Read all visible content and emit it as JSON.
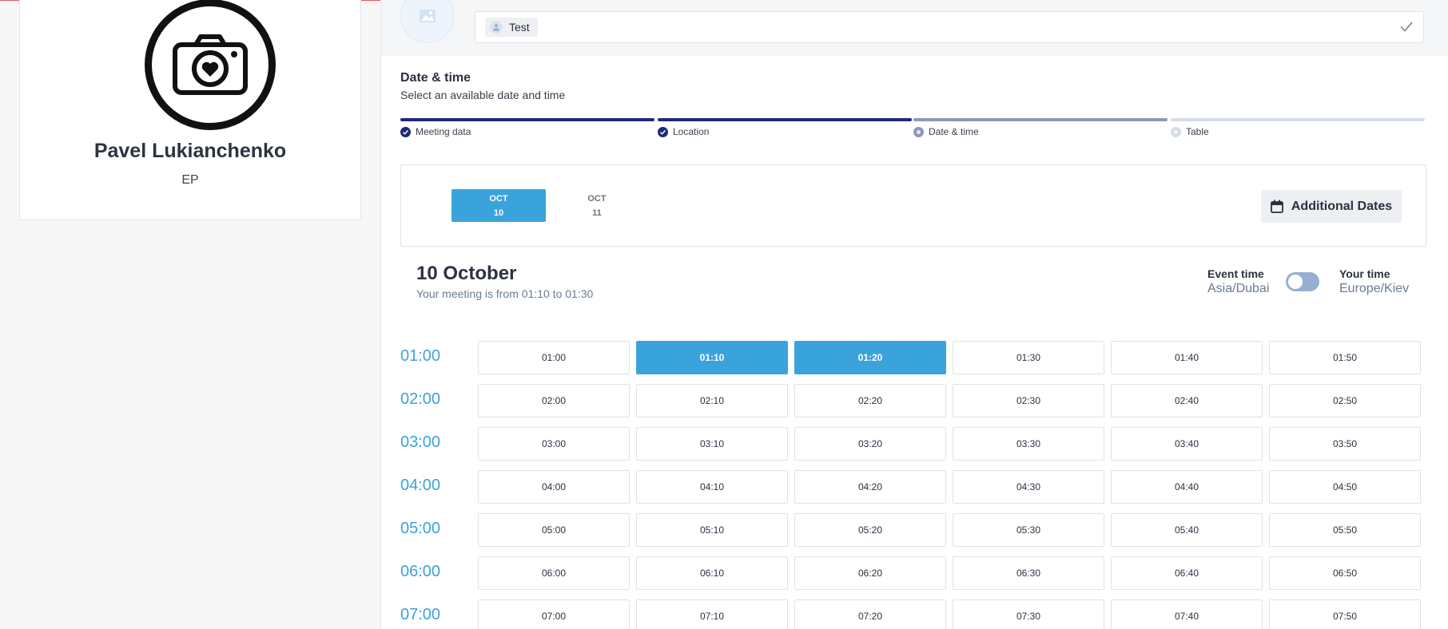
{
  "profile": {
    "name": "Pavel Lukianchenko",
    "subtitle": "EP"
  },
  "participants": {
    "chip_label": "Test"
  },
  "section": {
    "title": "Date & time",
    "subtitle": "Select an available date and time"
  },
  "steps": [
    {
      "label": "Meeting data",
      "state": "done"
    },
    {
      "label": "Location",
      "state": "done"
    },
    {
      "label": "Date & time",
      "state": "current"
    },
    {
      "label": "Table",
      "state": "pending"
    }
  ],
  "dates": [
    {
      "month": "OCT",
      "day": "10",
      "active": true
    },
    {
      "month": "OCT",
      "day": "11",
      "active": false
    }
  ],
  "additional_dates_label": "Additional Dates",
  "day": {
    "title": "10 October",
    "subtitle": "Your meeting is from 01:10 to 01:30"
  },
  "timezones": {
    "event_label": "Event time",
    "event_value": "Asia/Dubai",
    "your_label": "Your time",
    "your_value": "Europe/Kiev"
  },
  "hours": [
    {
      "hour": "01:00",
      "slots": [
        "01:00",
        "01:10",
        "01:20",
        "01:30",
        "01:40",
        "01:50"
      ]
    },
    {
      "hour": "02:00",
      "slots": [
        "02:00",
        "02:10",
        "02:20",
        "02:30",
        "02:40",
        "02:50"
      ]
    },
    {
      "hour": "03:00",
      "slots": [
        "03:00",
        "03:10",
        "03:20",
        "03:30",
        "03:40",
        "03:50"
      ]
    },
    {
      "hour": "04:00",
      "slots": [
        "04:00",
        "04:10",
        "04:20",
        "04:30",
        "04:40",
        "04:50"
      ]
    },
    {
      "hour": "05:00",
      "slots": [
        "05:00",
        "05:10",
        "05:20",
        "05:30",
        "05:40",
        "05:50"
      ]
    },
    {
      "hour": "06:00",
      "slots": [
        "06:00",
        "06:10",
        "06:20",
        "06:30",
        "06:40",
        "06:50"
      ]
    },
    {
      "hour": "07:00",
      "slots": [
        "07:00",
        "07:10",
        "07:20",
        "07:30",
        "07:40",
        "07:50"
      ]
    }
  ],
  "selected_slots": [
    "01:10",
    "01:20"
  ],
  "colors": {
    "accent": "#3ba3dc",
    "stepper_done": "#1f2a7a",
    "stepper_current": "#9096b8",
    "stepper_pending": "#d6dde6"
  }
}
